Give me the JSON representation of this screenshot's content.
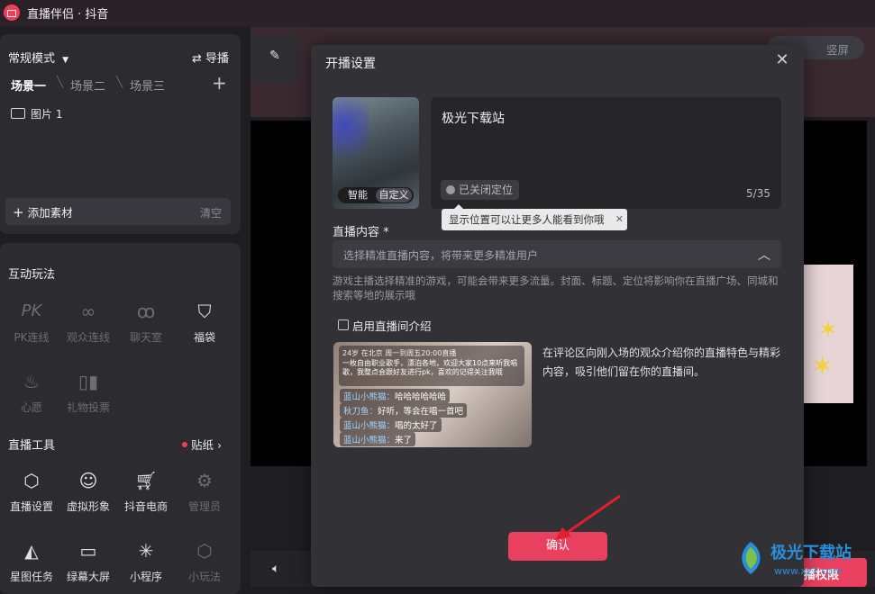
{
  "app": {
    "title": "直播伴侣 · 抖音"
  },
  "left": {
    "mode_label": "常规模式",
    "import_label": "导播",
    "scenes": [
      "场景一",
      "场景二",
      "场景三"
    ],
    "source_item": "图片 1",
    "add_material": "添加素材",
    "clear": "清空",
    "interactive_title": "互动玩法",
    "interactive_tools": [
      {
        "label": "PK连线",
        "icon": "pk-icon"
      },
      {
        "label": "观众连线",
        "icon": "link-icon"
      },
      {
        "label": "聊天室",
        "icon": "chatroom-icon"
      },
      {
        "label": "福袋",
        "icon": "lucky-bag-icon"
      },
      {
        "label": "心愿",
        "icon": "wish-icon"
      },
      {
        "label": "礼物投票",
        "icon": "vote-icon"
      }
    ],
    "live_tools_title": "直播工具",
    "sticker_label": "贴纸",
    "live_tools": [
      {
        "label": "直播设置",
        "icon": "settings-icon"
      },
      {
        "label": "虚拟形象",
        "icon": "avatar-icon"
      },
      {
        "label": "抖音电商",
        "icon": "cart-icon"
      },
      {
        "label": "管理员",
        "icon": "admin-icon"
      },
      {
        "label": "星图任务",
        "icon": "star-task-icon"
      },
      {
        "label": "绿幕大屏",
        "icon": "screen-icon"
      },
      {
        "label": "小程序",
        "icon": "mini-program-icon"
      },
      {
        "label": "小玩法",
        "icon": "mini-game-icon"
      }
    ]
  },
  "main": {
    "toggle_right": "竖屏",
    "bottom_button": "播权限"
  },
  "modal": {
    "title": "开播设置",
    "cover_tabs": [
      "智能",
      "自定义"
    ],
    "live_title": "极光下载站",
    "location_pill": "已关闭定位",
    "char_count": "5/35",
    "location_tip": "显示位置可以让更多人能看到你哦",
    "content_label": "直播内容 *",
    "content_placeholder": "选择精准直播内容，将带来更多精准用户",
    "content_desc": "游戏主播选择精准的游戏，可能会带来更多流量。封面、标题、定位将影响你在直播广场、同城和搜索等地的展示哦",
    "intro_checkbox_label": "启用直播间介绍",
    "intro_preview": {
      "header": "24岁  在北京  周一到周五20:00直播",
      "bio": "一枚自由职业歌手，漂泊各地，欢迎大家10点来听我唱歌，我整点会跟好友进行pk，喜欢的记得关注我哦",
      "chats": [
        {
          "name": "蓝山小熊猫：",
          "text": "哈哈哈哈哈哈"
        },
        {
          "name": "秋刀鱼：",
          "text": "好听，等会在唱一首吧"
        },
        {
          "name": "蓝山小熊猫：",
          "text": "唱的太好了"
        },
        {
          "name": "蓝山小熊猫：",
          "text": "来了"
        }
      ]
    },
    "intro_text": "在评论区向刚入场的观众介绍你的直播特色与精彩内容，吸引他们留在你的直播间。",
    "confirm": "确认"
  },
  "watermark": {
    "text": "极光下载站",
    "url_text": "www.xz7.com"
  },
  "colors": {
    "accent": "#e8405e",
    "panel": "#2b2b30",
    "modal": "#313136"
  }
}
